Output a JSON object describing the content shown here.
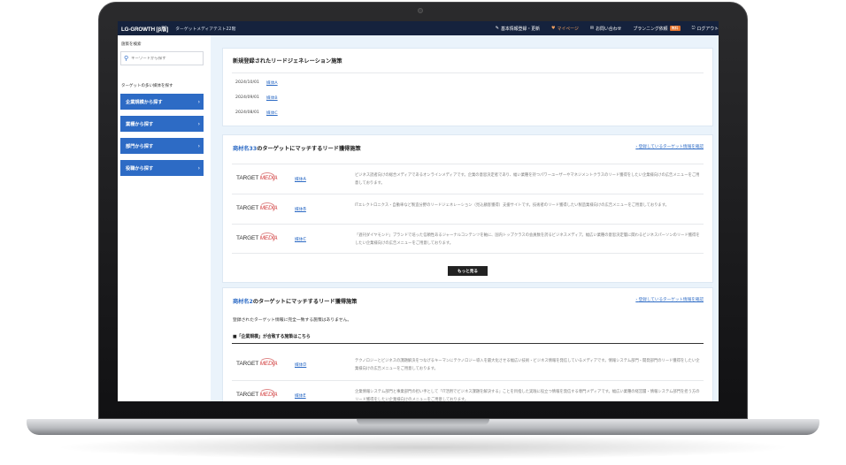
{
  "header": {
    "logo": "LG-GROWTH [β版]",
    "site_name": "ターゲットメディアテスト22階",
    "nav": [
      {
        "icon": "✎",
        "label": "基本情報登録・更新"
      },
      {
        "icon": "♥",
        "label": "マイページ"
      },
      {
        "icon": "✉",
        "label": "お問い合わせ"
      },
      {
        "icon": "",
        "label": "プランニング依頼",
        "badge": "無料"
      },
      {
        "icon": "⎋",
        "label": "ログアウト"
      }
    ]
  },
  "sidebar": {
    "search_label": "施策を検索",
    "search_placeholder": "キーワードから探す",
    "target_label": "ターゲットの多い媒体を探す",
    "buttons": [
      "企業規模から探す",
      "業種から探す",
      "部門から探す",
      "役職から探す"
    ]
  },
  "new_section": {
    "title": "新規登録されたリードジェネレーション施策",
    "items": [
      {
        "date": "2024/10/01",
        "link": "媒体A"
      },
      {
        "date": "2024/09/01",
        "link": "媒体B"
      },
      {
        "date": "2024/08/01",
        "link": "媒体C"
      }
    ]
  },
  "section1": {
    "title_highlight": "商材名33",
    "title_rest": "のターゲットにマッチするリード獲得施策",
    "side_link": "登録しているターゲット情報を確認",
    "media_logo_a": "TARGET ",
    "media_logo_b": "MEDIA",
    "rows": [
      {
        "link": "媒体A",
        "desc": "ビジネス読者向けの総合メディアであるオンラインメディアです。企業の意思決定者であり、幅い業種を持つパワーユーザーやマネジメントクラスのリード獲得をしたい企業様向けの広告メニューをご用意しております。"
      },
      {
        "link": "媒体B",
        "desc": "ITエレクトロニクス・自動車など製造分野のリードジェネレーション（見込顧客獲得）支援サイトです。技術者のリード獲得したい製造業様向けの広告メニューをご用意しております。"
      },
      {
        "link": "媒体C",
        "desc": "「週刊ダイヤモンド」ブランドで培った信頼性あるジャーナルコンテンツを軸に、国内トップクラスの会員数を誇るビジネスメディア。幅広い業種の意思決定層に関わるビジネスパーソンのリード獲得をしたい企業様向けの広告メニューをご用意しております。"
      }
    ],
    "more_button": "もっと見る"
  },
  "section2": {
    "title_highlight": "商材名2",
    "title_rest": "のターゲットにマッチするリード獲得施策",
    "side_link": "登録しているターゲット情報を確認",
    "notice": "登録されたターゲット情報に完全一致する施策はありません。",
    "sub_heading": "■「企業規模」が合致する施策はこちら",
    "rows": [
      {
        "link": "媒体D",
        "desc": "テクノロジーとビジネスの課題解決をつなげるキーマンにテクノロジー導入を最大化させる幅広い技術・ビジネス情報を発信しているメディアです。情報システム部門・開発部門のリード獲得をしたい企業様向けの広告メニューをご用意しております。"
      },
      {
        "link": "媒体E",
        "desc": "企業情報システム部門と事業部門の担い手として「IT活用でビジネス課題を解決する」ことを目指した実践に役立つ情報を発信する専門メディアです。幅広い業種の経営層・情報システム部門を担う方のリード獲得をしたい企業様向けのメニューをご用意しております。"
      }
    ]
  }
}
